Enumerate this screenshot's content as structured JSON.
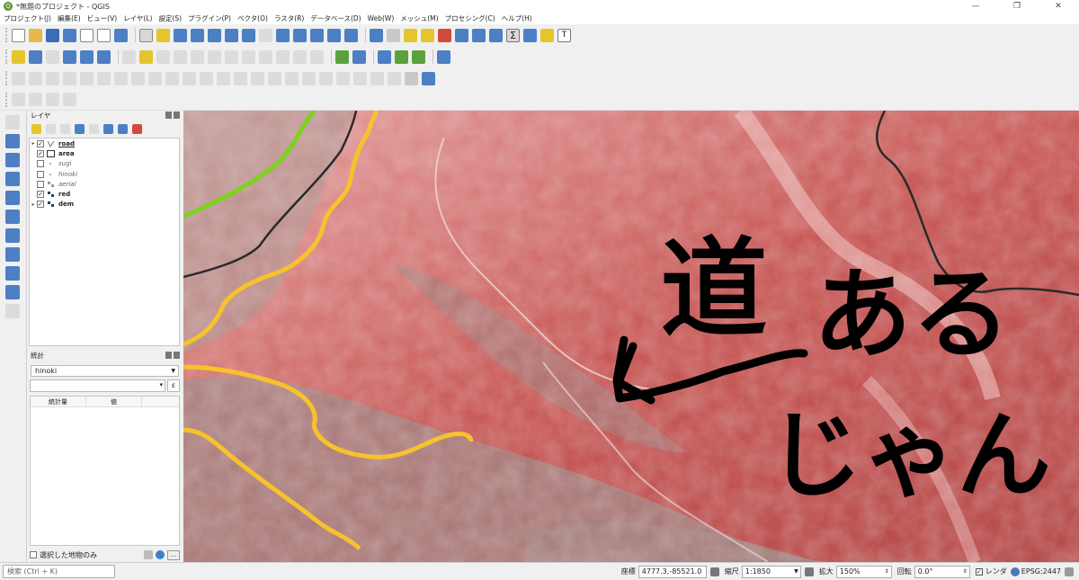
{
  "window": {
    "title": "*無題のプロジェクト - QGIS",
    "minimize": "—",
    "maximize": "❐",
    "close": "✕"
  },
  "menu": [
    "プロジェクト(J)",
    "編集(E)",
    "ビュー(V)",
    "レイヤ(L)",
    "設定(S)",
    "プラグイン(P)",
    "ベクタ(O)",
    "ラスタ(R)",
    "データベース(D)",
    "Web(W)",
    "メッシュ(M)",
    "プロセシング(C)",
    "ヘルプ(H)"
  ],
  "layers_panel": {
    "title": "レイヤ",
    "layers": [
      {
        "name": "road",
        "checked": true,
        "expand": "▸",
        "symbol": "vector",
        "style": "bu"
      },
      {
        "name": "area",
        "checked": true,
        "expand": "",
        "symbol": "square",
        "style": "b"
      },
      {
        "name": "sugi",
        "checked": false,
        "expand": "",
        "symbol": "dot",
        "style": "i"
      },
      {
        "name": "hinoki",
        "checked": false,
        "expand": "",
        "symbol": "dot",
        "style": "i"
      },
      {
        "name": "aerial",
        "checked": false,
        "expand": "",
        "symbol": "raster",
        "style": "i"
      },
      {
        "name": "red",
        "checked": true,
        "expand": "",
        "symbol": "raster",
        "style": "b"
      },
      {
        "name": "dem",
        "checked": true,
        "expand": "▸",
        "symbol": "raster",
        "style": "b"
      }
    ]
  },
  "stats_panel": {
    "title": "統計",
    "selected_layer": "hinoki",
    "expression_button": "ε",
    "col_stat": "統計量",
    "col_value": "値",
    "selected_only_label": "選択した地物のみ",
    "more_button": "..."
  },
  "map": {
    "annotation_line1": "道",
    "annotation_line2": "ある",
    "annotation_line3": "じゃん",
    "arrow_color": "#000000",
    "yellow_line_color": "#f7c22c",
    "green_line_color": "#7fd11f",
    "road_line_color": "#2a2a2a"
  },
  "statusbar": {
    "search_placeholder": "検索 (Ctrl + K)",
    "coord_label": "座標",
    "coord_value": "4777.3,-85521.0",
    "scale_label": "縮尺",
    "scale_value": "1:1850",
    "magnify_label": "拡大",
    "magnify_value": "150%",
    "rotation_label": "回転",
    "rotation_value": "0.0°",
    "render_label": "レンダ",
    "crs": "EPSG:2447"
  }
}
